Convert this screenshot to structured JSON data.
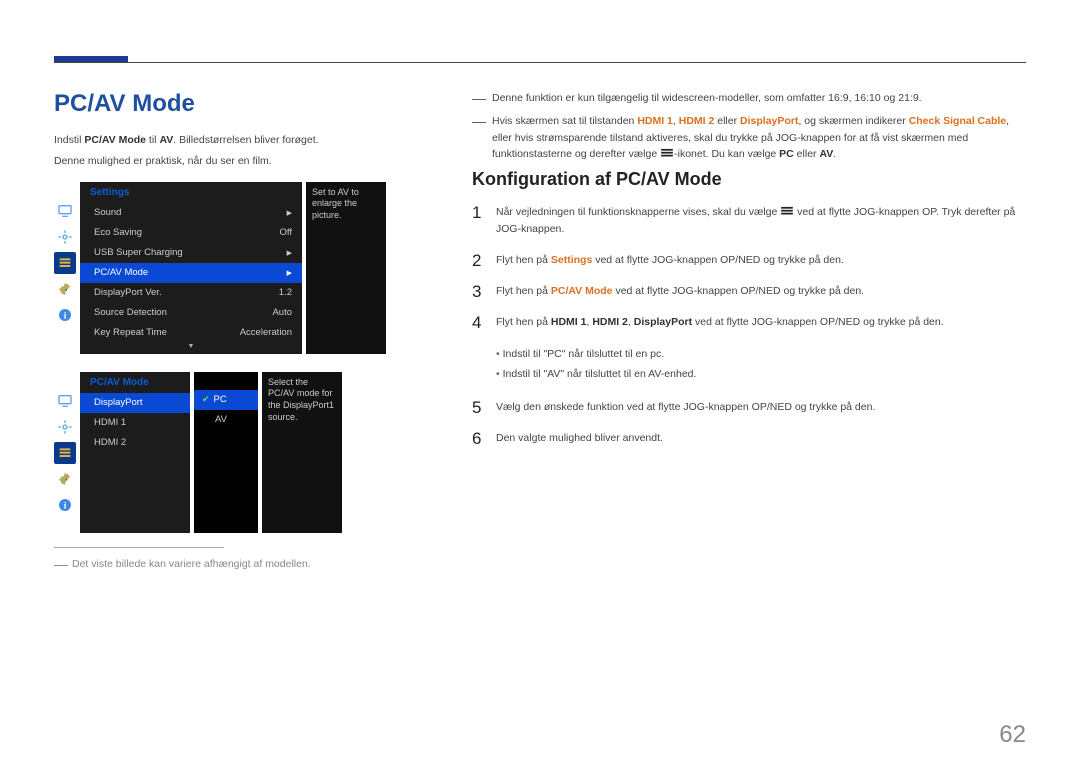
{
  "page_number": "62",
  "left": {
    "title": "PC/AV Mode",
    "intro_pre": "Indstil ",
    "intro_bold": "PC/AV Mode",
    "intro_mid": " til ",
    "intro_bold2": "AV",
    "intro_post": ". Billedstørrelsen bliver forøget.",
    "intro2": "Denne mulighed er praktisk, når du ser en film.",
    "osd1": {
      "header": "Settings",
      "tip": "Set to AV to enlarge the picture.",
      "rows": [
        {
          "label": "Sound",
          "value": "▶"
        },
        {
          "label": "Eco Saving",
          "value": "Off"
        },
        {
          "label": "USB Super Charging",
          "value": "▶"
        },
        {
          "label": "PC/AV Mode",
          "value": "▶",
          "selected": true
        },
        {
          "label": "DisplayPort Ver.",
          "value": "1.2"
        },
        {
          "label": "Source Detection",
          "value": "Auto"
        },
        {
          "label": "Key Repeat Time",
          "value": "Acceleration"
        }
      ]
    },
    "osd2": {
      "header": "PC/AV Mode",
      "tip": "Select the PC/AV mode for the DisplayPort1 source.",
      "rows": [
        {
          "label": "DisplayPort",
          "selected": true
        },
        {
          "label": "HDMI 1"
        },
        {
          "label": "HDMI 2"
        }
      ],
      "sub": [
        {
          "label": "PC",
          "checked": true
        },
        {
          "label": "AV"
        }
      ]
    },
    "footnote": "Det viste billede kan variere afhængigt af modellen."
  },
  "right": {
    "note_a": "Denne funktion er kun tilgængelig til widescreen-modeller, som omfatter 16:9, 16:10 og 21:9.",
    "note_b_pre": "Hvis skærmen sat til tilstanden ",
    "hdmi1": "HDMI 1",
    "sep": ", ",
    "hdmi2": "HDMI 2",
    "or": " eller ",
    "dp": "DisplayPort",
    "check_pre": ", og skærmen indikerer ",
    "check": "Check Signal Cable",
    "note_b_post": ", eller hvis strømsparende tilstand aktiveres, skal du trykke på JOG-knappen for at få vist skærmen med funktionstasterne og derefter vælge ",
    "note_b_tail": "-ikonet. Du kan vælge ",
    "pc": "PC",
    "av": "AV",
    "period": ".",
    "subtitle": "Konfiguration af PC/AV Mode",
    "steps": [
      {
        "num": "1",
        "pre": "Når vejledningen til funktionsknapperne vises, skal du vælge ",
        "post": " ved at flytte JOG-knappen OP. Tryk derefter på JOG-knappen."
      },
      {
        "num": "2",
        "pre": "Flyt hen på ",
        "orange": "Settings",
        "post": " ved at flytte JOG-knappen OP/NED og trykke på den."
      },
      {
        "num": "3",
        "pre": "Flyt hen på ",
        "orange": "PC/AV Mode",
        "post": " ved at flytte JOG-knappen OP/NED og trykke på den."
      },
      {
        "num": "4",
        "pre": "Flyt hen på ",
        "b1": "HDMI 1",
        "b2": "HDMI 2",
        "b3": "DisplayPort",
        "post": " ved at flytte JOG-knappen OP/NED og trykke på den."
      }
    ],
    "bullets": [
      "Indstil til \"PC\" når tilsluttet til en pc.",
      "Indstil til \"AV\" når tilsluttet til en AV-enhed."
    ],
    "step5": {
      "num": "5",
      "text": "Vælg den ønskede funktion ved at flytte JOG-knappen OP/NED og trykke på den."
    },
    "step6": {
      "num": "6",
      "text": "Den valgte mulighed bliver anvendt."
    }
  }
}
